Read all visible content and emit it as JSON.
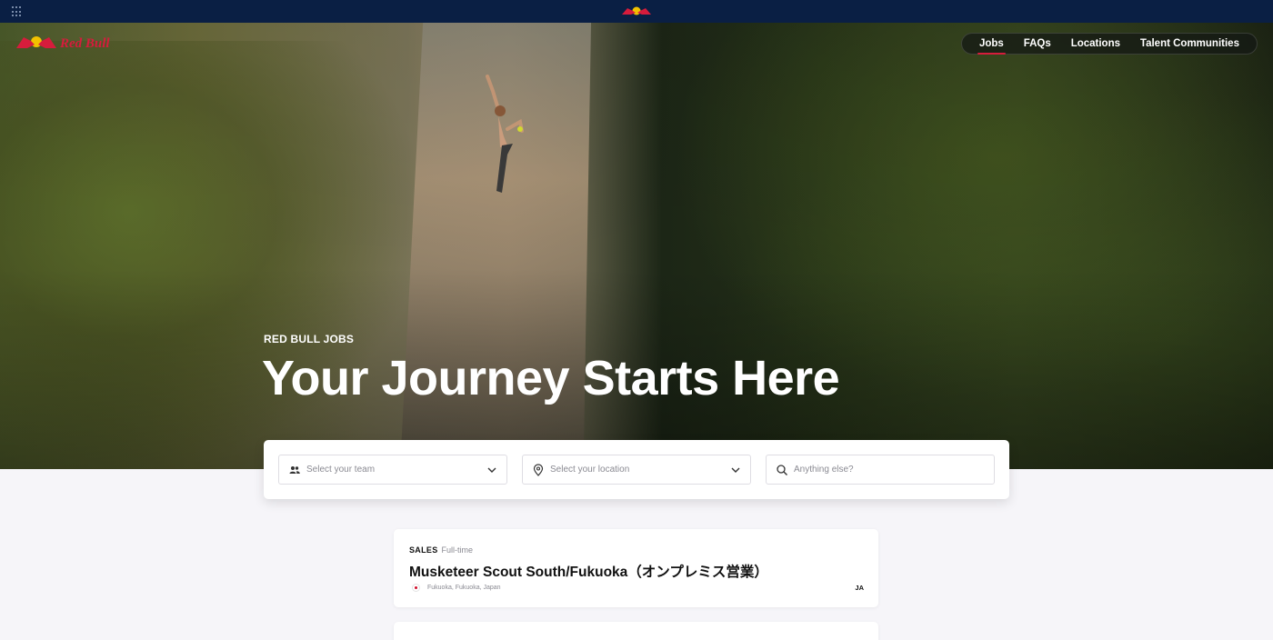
{
  "topbar": {
    "apps_icon": "apps-grid-icon",
    "logo": "red-bull-emblem"
  },
  "brand": {
    "logo_text": "Red Bull"
  },
  "nav": {
    "items": [
      {
        "label": "Jobs",
        "active": true
      },
      {
        "label": "FAQs",
        "active": false
      },
      {
        "label": "Locations",
        "active": false
      },
      {
        "label": "Talent Communities",
        "active": false
      }
    ]
  },
  "hero": {
    "eyebrow": "RED BULL JOBS",
    "headline": "Your Journey Starts Here"
  },
  "search": {
    "team_placeholder": "Select your team",
    "location_placeholder": "Select your location",
    "text_placeholder": "Anything else?"
  },
  "jobs": [
    {
      "department": "SALES",
      "type": "Full-time",
      "title": "Musketeer Scout South/Fukuoka（オンプレミス営業）",
      "location": "Fukuoka, Fukuoka, Japan",
      "language": "JA"
    }
  ],
  "colors": {
    "topbar": "#0a1f44",
    "accent": "#d61c3c",
    "page_bg": "#f6f5f9"
  }
}
